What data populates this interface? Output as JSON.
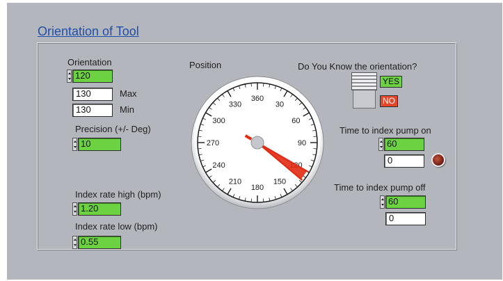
{
  "panel": {
    "title": "Orientation of Tool"
  },
  "orientation": {
    "label": "Orientation",
    "value": "120",
    "max_value": "130",
    "max_label": "Max",
    "min_value": "130",
    "min_label": "Min"
  },
  "precision": {
    "label": "Precision (+/- Deg)",
    "value": "10"
  },
  "index_rate_high": {
    "label": "Index rate high (bpm)",
    "value": "1.20"
  },
  "index_rate_low": {
    "label": "Index rate low (bpm)",
    "value": "0.55"
  },
  "position": {
    "label": "Position",
    "dial_labels": [
      "360",
      "30",
      "60",
      "90",
      "120",
      "150",
      "180",
      "210",
      "240",
      "270",
      "300",
      "330"
    ],
    "needle_value_deg": 108,
    "needle_high_deg": 120,
    "needle_low_deg": 130,
    "marker_deg": 300
  },
  "know_orientation": {
    "label": "Do You Know the orientation?",
    "yes_label": "YES",
    "no_label": "NO"
  },
  "pump_on": {
    "label": "Time to index pump on",
    "value": "60",
    "readout": "0"
  },
  "pump_off": {
    "label": "Time to index pump off",
    "value": "60",
    "readout": "0"
  },
  "colors": {
    "green": "#6dd241",
    "red": "#e5472a",
    "needle": "#e02a12",
    "title": "#1f4fa8"
  }
}
